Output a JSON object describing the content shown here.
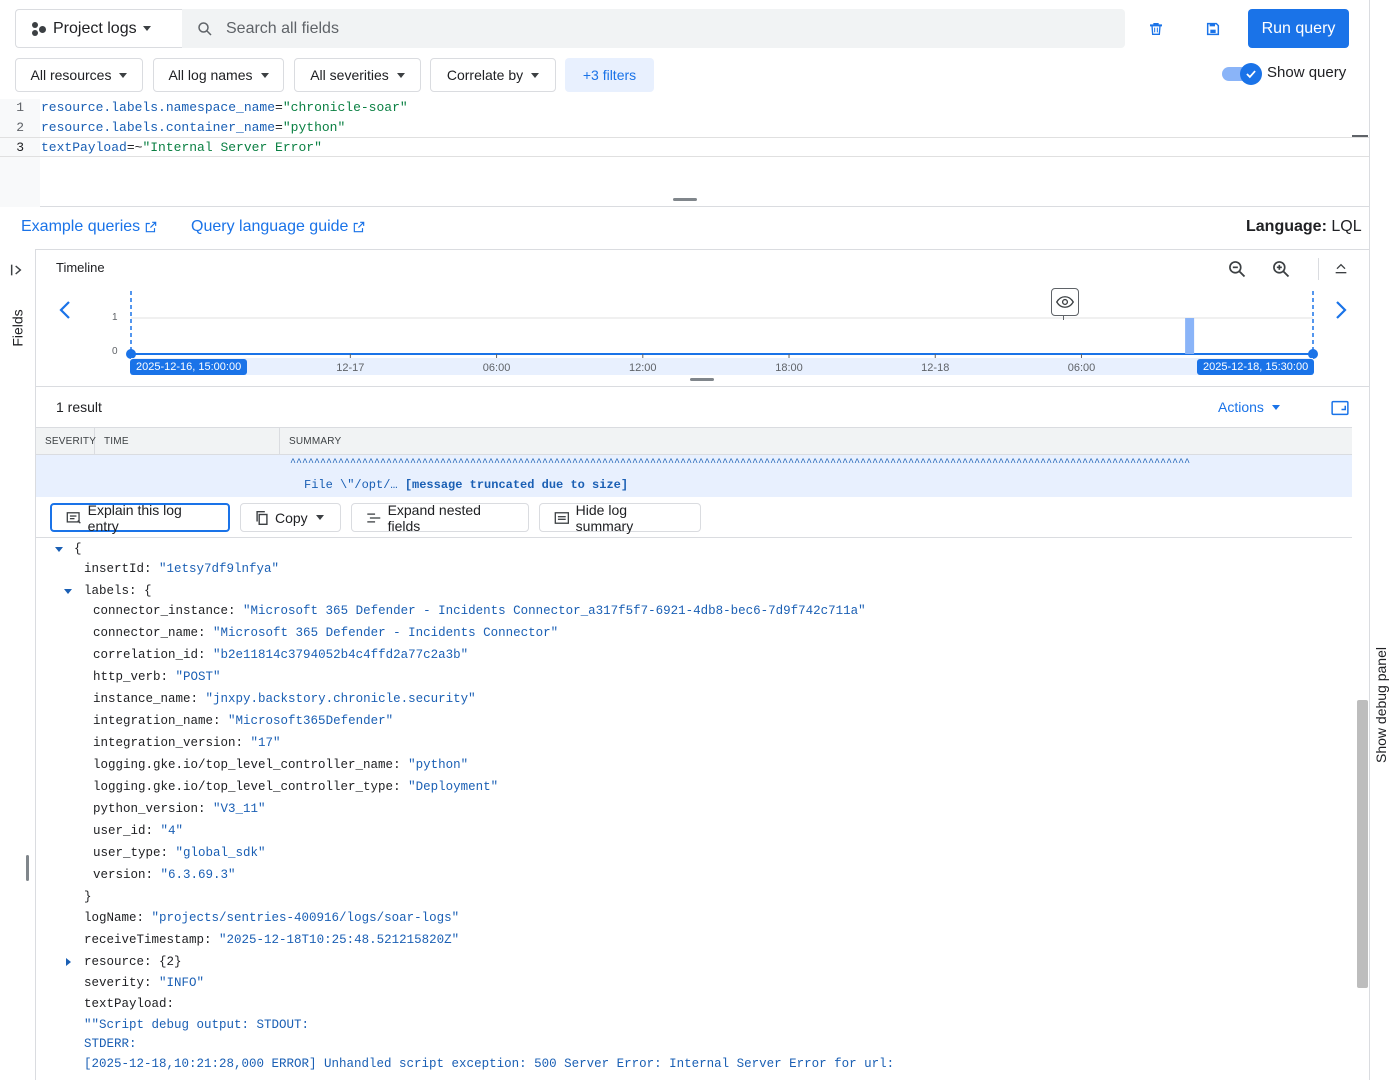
{
  "header": {
    "project_label": "Project logs",
    "search_placeholder": "Search all fields",
    "run_query_label": "Run query"
  },
  "filters": {
    "resources": "All resources",
    "log_names": "All log names",
    "severities": "All severities",
    "correlate": "Correlate by",
    "more": "+3 filters",
    "show_query": "Show query",
    "show_query_on": true
  },
  "editor": {
    "lines": [
      {
        "num": "1",
        "field": "resource.labels.namespace_name",
        "op": "=",
        "value": "\"chronicle-soar\""
      },
      {
        "num": "2",
        "field": "resource.labels.container_name",
        "op": "=",
        "value": "\"python\""
      },
      {
        "num": "3",
        "field": "textPayload",
        "op": "=~",
        "value": "\"Internal Server Error\""
      }
    ]
  },
  "links": {
    "example_queries": "Example queries",
    "query_guide": "Query language guide",
    "language_label": "Language:",
    "language_value": "LQL"
  },
  "sidebar": {
    "fields_label": "Fields"
  },
  "timeline": {
    "title": "Timeline",
    "y_ticks": [
      "1",
      "0"
    ],
    "x_ticks": [
      "12-17",
      "06:00",
      "12:00",
      "18:00",
      "12-18",
      "06:00"
    ],
    "range_start": "2025-12-16, 15:00:00",
    "range_end": "2025-12-18, 15:30:00"
  },
  "chart_data": {
    "type": "bar",
    "title": "Timeline",
    "x_range": [
      "2025-12-16 15:00:00",
      "2025-12-18 15:30:00"
    ],
    "x_tick_labels": [
      "12-17",
      "06:00",
      "12:00",
      "18:00",
      "12-18",
      "06:00"
    ],
    "y_ticks": [
      0,
      1
    ],
    "series": [
      {
        "x": [
          "2025-12-18 10:25"
        ],
        "values": [
          1
        ]
      }
    ]
  },
  "results": {
    "count": "1 result",
    "actions": "Actions",
    "columns": [
      "SEVERITY",
      "TIME",
      "SUMMARY"
    ],
    "summary_carets": "^^^^^^^^^^^^^^^^^^^^^^^^^^^^^^^^^^^^^^^^^^^^^^^^^^^^^^^^^^^^^^^^^^^^^^^^^^^^^^^^^^^^^^^^^^^^^^^^^^^^^^^^^^^^^^^^^^^^^^^^^^^^^^^^^^^^^^^^^^^^^^^^^^^^^^",
    "summary_file": "File \\\"/opt/…",
    "summary_truncated": "[message truncated due to size]"
  },
  "entry_actions": {
    "explain": "Explain this log entry",
    "copy": "Copy",
    "expand": "Expand nested fields",
    "hide": "Hide log summary"
  },
  "log_entry": {
    "open_brace": "{",
    "insertId_key": "insertId",
    "insertId": "\"1etsy7df9lnfya\"",
    "labels_key": "labels",
    "labels_open": "{",
    "labels": [
      {
        "k": "connector_instance",
        "v": "\"Microsoft 365 Defender - Incidents Connector_a317f5f7-6921-4db8-bec6-7d9f742c711a\""
      },
      {
        "k": "connector_name",
        "v": "\"Microsoft 365 Defender - Incidents Connector\""
      },
      {
        "k": "correlation_id",
        "v": "\"b2e11814c3794052b4c4ffd2a77c2a3b\""
      },
      {
        "k": "http_verb",
        "v": "\"POST\""
      },
      {
        "k": "instance_name",
        "v": "\"jnxpy.backstory.chronicle.security\""
      },
      {
        "k": "integration_name",
        "v": "\"Microsoft365Defender\""
      },
      {
        "k": "integration_version",
        "v": "\"17\""
      },
      {
        "k": "logging.gke.io/top_level_controller_name",
        "v": "\"python\""
      },
      {
        "k": "logging.gke.io/top_level_controller_type",
        "v": "\"Deployment\""
      },
      {
        "k": "python_version",
        "v": "\"V3_11\""
      },
      {
        "k": "user_id",
        "v": "\"4\""
      },
      {
        "k": "user_type",
        "v": "\"global_sdk\""
      },
      {
        "k": "version",
        "v": "\"6.3.69.3\""
      }
    ],
    "labels_close": "}",
    "logName_key": "logName",
    "logName": "\"projects/sentries-400916/logs/soar-logs\"",
    "receiveTimestamp_key": "receiveTimestamp",
    "receiveTimestamp": "\"2025-12-18T10:25:48.521215820Z\"",
    "resource_key": "resource",
    "resource": "{2}",
    "severity_key": "severity",
    "severity": "\"INFO\"",
    "textPayload_key": "textPayload",
    "payload_line1": "\"\"Script debug output: STDOUT:",
    "payload_line2": "STDERR:",
    "payload_line3": "[2025-12-18,10:21:28,000 ERROR] Unhandled script exception: 500 Server Error: Internal Server Error for url:"
  },
  "right_panel": {
    "debug_label": "Show debug panel"
  }
}
